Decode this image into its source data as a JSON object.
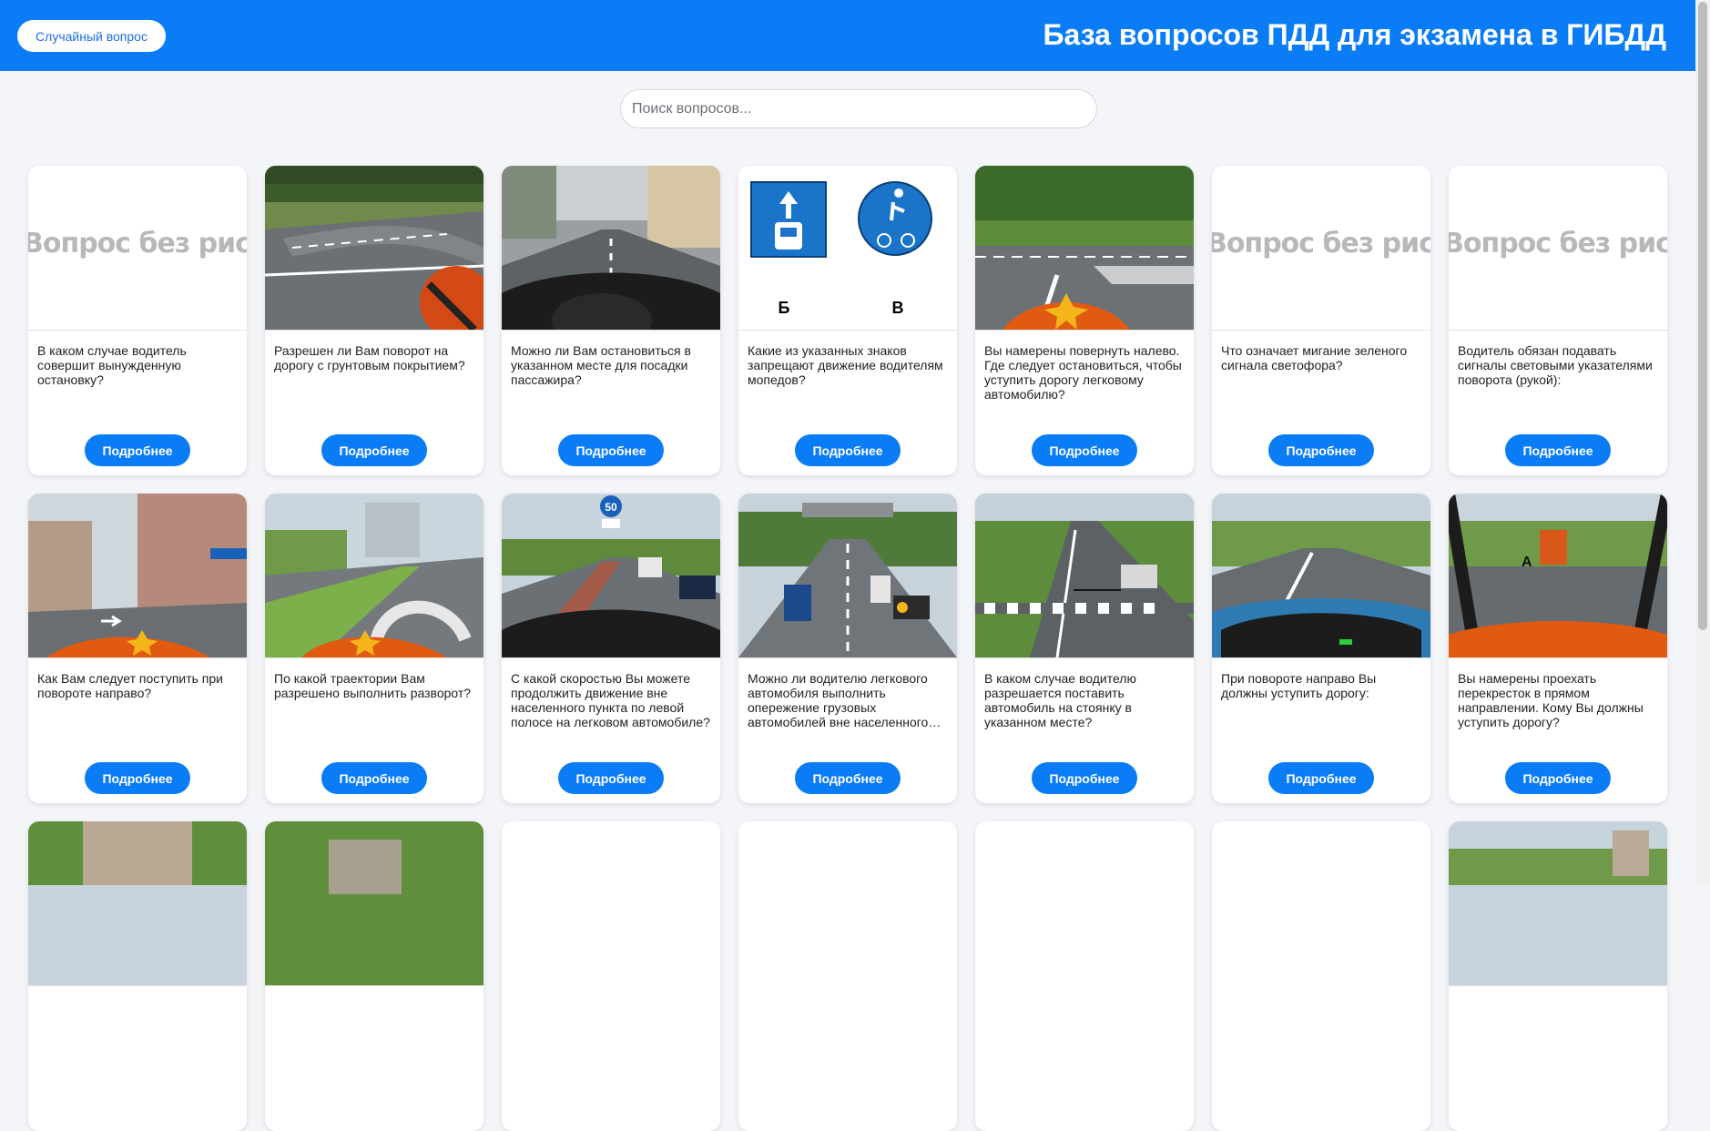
{
  "header": {
    "random_button": "Случайный вопрос",
    "title": "База вопросов ПДД для экзамена в ГИБДД"
  },
  "search": {
    "placeholder": "Поиск вопросов..."
  },
  "colors": {
    "brand": "#0a7cf5",
    "background": "#f4f5f9"
  },
  "no_image_text": "Вопрос без рисунка",
  "more_label": "Подробнее",
  "sign_labels": {
    "b": "Б",
    "v": "В",
    "speed": "50",
    "a": "А"
  },
  "cards": [
    {
      "question": "В каком случае водитель совершит вынужденную остановку?"
    },
    {
      "question": "Разрешен ли Вам поворот на дорогу с грунтовым покрытием?"
    },
    {
      "question": "Можно ли Вам остановиться в указанном месте для посадки пассажира?"
    },
    {
      "question": "Какие из указанных знаков запрещают движение водителям мопедов?"
    },
    {
      "question": "Вы намерены повернуть налево. Где следует остановиться, чтобы уступить дорогу легковому автомобилю?"
    },
    {
      "question": "Что означает мигание зеленого сигнала светофора?"
    },
    {
      "question": "Водитель обязан подавать сигналы световыми указателями поворота (рукой):"
    },
    {
      "question": "Как Вам следует поступить при повороте направо?"
    },
    {
      "question": "По какой траектории Вам разрешено выполнить разворот?"
    },
    {
      "question": "С какой скоростью Вы можете продолжить движение вне населенного пункта по левой полосе на легковом автомобиле?"
    },
    {
      "question": "Можно ли водителю легкового автомобиля выполнить опережение грузовых автомобилей вне населенного…"
    },
    {
      "question": "В каком случае водителю разрешается поставить автомобиль на стоянку в указанном месте?"
    },
    {
      "question": "При повороте направо Вы должны уступить дорогу:"
    },
    {
      "question": "Вы намерены проехать перекресток в прямом направлении. Кому Вы должны уступить дорогу?"
    }
  ]
}
